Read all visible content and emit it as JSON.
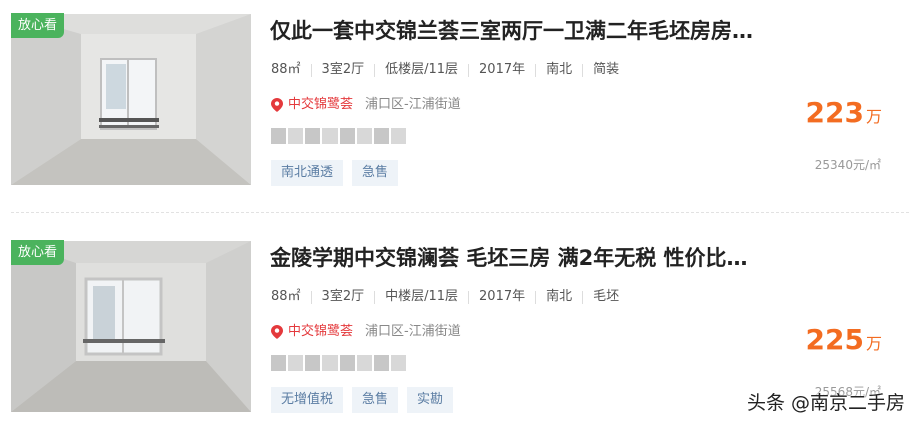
{
  "listings": [
    {
      "badge": "放心看",
      "title": "仅此一套中交锦兰荟三室两厅一卫满二年毛坯房房…",
      "meta": [
        "88㎡",
        "3室2厅",
        "低楼层/11层",
        "2017年",
        "南北",
        "简装"
      ],
      "community": "中交锦鹭荟",
      "district": "浦口区-江浦街道",
      "tags": [
        "南北通透",
        "急售"
      ],
      "price": "223",
      "price_unit": "万",
      "unit_price": "25340元/㎡"
    },
    {
      "badge": "放心看",
      "title": "金陵学期中交锦澜荟 毛坯三房 满2年无税 性价比…",
      "meta": [
        "88㎡",
        "3室2厅",
        "中楼层/11层",
        "2017年",
        "南北",
        "毛坯"
      ],
      "community": "中交锦鹭荟",
      "district": "浦口区-江浦街道",
      "tags": [
        "无增值税",
        "急售",
        "实勘"
      ],
      "price": "225",
      "price_unit": "万",
      "unit_price": "25568元/㎡"
    }
  ],
  "watermark": {
    "text": "头条 @南京二手房"
  },
  "icons": {
    "location": "map-pin-icon"
  },
  "colors": {
    "price": "#f36c21",
    "badge": "#4bb35d",
    "community": "#e4393c",
    "tag_bg": "#eef3f8"
  }
}
